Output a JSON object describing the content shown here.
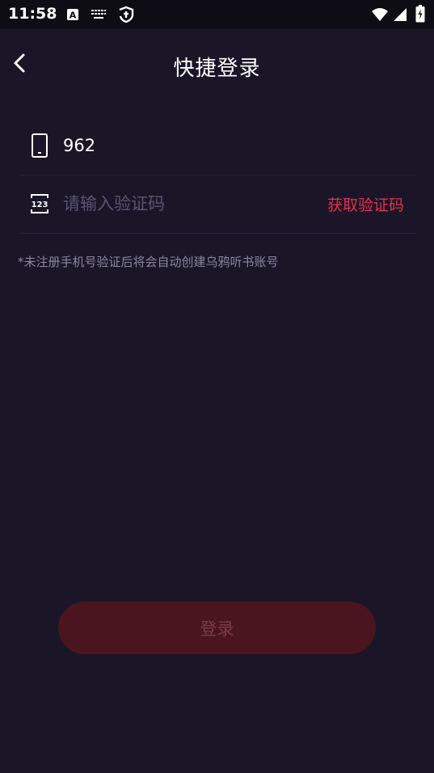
{
  "status_bar": {
    "time": "11:58"
  },
  "header": {
    "title": "快捷登录"
  },
  "form": {
    "phone_value": "962",
    "code_placeholder": "请输入验证码",
    "get_code_label": "获取验证码",
    "code_icon_text": "123"
  },
  "notice": "*未注册手机号验证后将会自动创建乌鸦听书账号",
  "login_label": "登录",
  "colors": {
    "background": "#1a1628",
    "accent": "#e0324a",
    "button_disabled": "#4a151f"
  },
  "icons": [
    "back-arrow-icon",
    "phone-icon",
    "verification-code-icon",
    "wifi-icon",
    "signal-icon",
    "battery-icon",
    "accessibility-icon",
    "keyboard-icon",
    "debug-icon"
  ]
}
